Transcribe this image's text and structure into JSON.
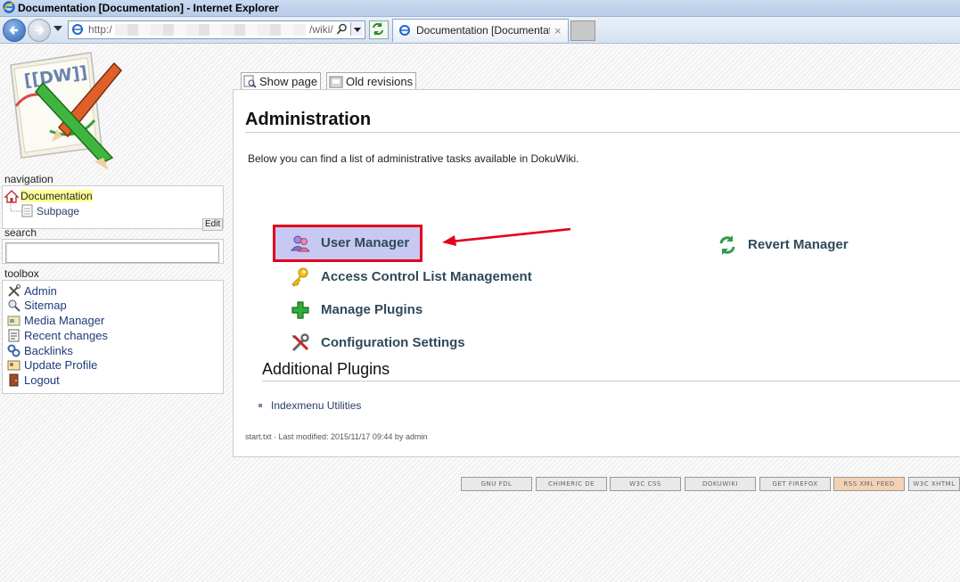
{
  "browser": {
    "window_title": "Documentation [Documentation] - Internet Explorer",
    "address": {
      "prefix": "http:/",
      "suffix": "/wiki/"
    },
    "tab_label": "Documentation [Documentati...",
    "tab_close": "×"
  },
  "sidebar": {
    "navigation_heading": "navigation",
    "navigation_items": [
      {
        "label": "Documentation",
        "icon": "home-icon",
        "current": true
      },
      {
        "label": "Subpage",
        "icon": "page-icon"
      }
    ],
    "edit_label": "Edit",
    "search_heading": "search",
    "search_value": "",
    "toolbox_heading": "toolbox",
    "toolbox_items": [
      {
        "label": "Admin",
        "icon": "tools-icon"
      },
      {
        "label": "Sitemap",
        "icon": "sitemap-icon"
      },
      {
        "label": "Media Manager",
        "icon": "media-icon"
      },
      {
        "label": "Recent changes",
        "icon": "recent-changes-icon"
      },
      {
        "label": "Backlinks",
        "icon": "backlinks-icon"
      },
      {
        "label": "Update Profile",
        "icon": "profile-icon"
      },
      {
        "label": "Logout",
        "icon": "logout-icon"
      }
    ]
  },
  "page_tabs": {
    "show_page": "Show page",
    "old_revisions": "Old revisions"
  },
  "content": {
    "title": "Administration",
    "intro": "Below you can find a list of administrative tasks available in DokuWiki.",
    "tasks": [
      {
        "label": "User Manager",
        "icon": "users-icon",
        "highlighted": true
      },
      {
        "label": "Access Control List Management",
        "icon": "key-icon"
      },
      {
        "label": "Manage Plugins",
        "icon": "plus-icon"
      },
      {
        "label": "Configuration Settings",
        "icon": "wrench-icon"
      },
      {
        "label": "Revert Manager",
        "icon": "revert-icon"
      }
    ],
    "additional_heading": "Additional Plugins",
    "additional_plugins": [
      "Indexmenu Utilities"
    ],
    "docinfo": "start.txt · Last modified: 2015/11/17 09:44 by admin"
  },
  "footer_badges": [
    "GNU FDL",
    "CHIMERIC DE",
    "W3C CSS",
    "DOKUWIKI",
    "GET FIREFOX",
    "RSS XML FEED",
    "W3C XHTML"
  ],
  "colors": {
    "highlight_border": "#e3001b",
    "arrow": "#e3001b",
    "current_nav": "#ffff99"
  }
}
